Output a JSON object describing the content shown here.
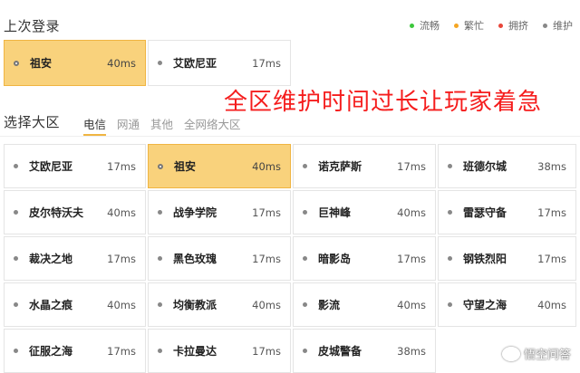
{
  "last_login": {
    "title": "上次登录",
    "servers": [
      {
        "name": "祖安",
        "ms": "40ms",
        "selected": true
      },
      {
        "name": "艾欧尼亚",
        "ms": "17ms",
        "selected": false
      }
    ]
  },
  "legend": [
    {
      "label": "流畅",
      "color": "#3cc83c"
    },
    {
      "label": "繁忙",
      "color": "#f5a623"
    },
    {
      "label": "拥挤",
      "color": "#e8463a"
    },
    {
      "label": "维护",
      "color": "#888888"
    }
  ],
  "overlay_text": "全区维护时间过长让玩家着急",
  "region": {
    "title": "选择大区",
    "tabs": [
      {
        "label": "电信",
        "active": true
      },
      {
        "label": "网通",
        "active": false
      },
      {
        "label": "其他",
        "active": false
      },
      {
        "label": "全网络大区",
        "active": false
      }
    ]
  },
  "servers": [
    {
      "name": "艾欧尼亚",
      "ms": "17ms"
    },
    {
      "name": "祖安",
      "ms": "40ms",
      "selected": true
    },
    {
      "name": "诺克萨斯",
      "ms": "17ms"
    },
    {
      "name": "班德尔城",
      "ms": "38ms"
    },
    {
      "name": "皮尔特沃夫",
      "ms": "40ms"
    },
    {
      "name": "战争学院",
      "ms": "17ms"
    },
    {
      "name": "巨神峰",
      "ms": "40ms"
    },
    {
      "name": "雷瑟守备",
      "ms": "17ms"
    },
    {
      "name": "裁决之地",
      "ms": "17ms"
    },
    {
      "name": "黑色玫瑰",
      "ms": "17ms"
    },
    {
      "name": "暗影岛",
      "ms": "17ms"
    },
    {
      "name": "钢铁烈阳",
      "ms": "17ms"
    },
    {
      "name": "水晶之痕",
      "ms": "40ms"
    },
    {
      "name": "均衡教派",
      "ms": "40ms"
    },
    {
      "name": "影流",
      "ms": "40ms"
    },
    {
      "name": "守望之海",
      "ms": "40ms"
    },
    {
      "name": "征服之海",
      "ms": "17ms"
    },
    {
      "name": "卡拉曼达",
      "ms": "17ms"
    },
    {
      "name": "皮城警备",
      "ms": "38ms"
    }
  ],
  "watermark": "悟空问答"
}
